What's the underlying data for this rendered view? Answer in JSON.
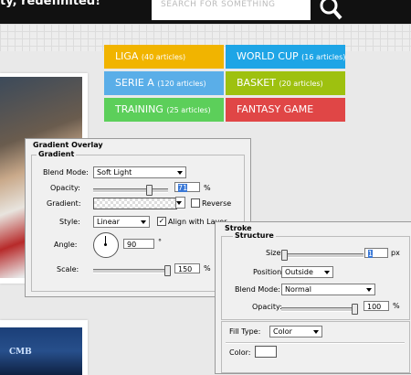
{
  "site": {
    "tagline": "ty, redefinited!",
    "search_placeholder": "SEARCH FOR SOMETHING"
  },
  "tiles": [
    {
      "label": "LIGA",
      "count": "(40 articles)",
      "color": "#f1b400"
    },
    {
      "label": "WORLD CUP",
      "count": "(16 articles)",
      "color": "#1ea5e6"
    },
    {
      "label": "SERIE A",
      "count": "(120 articles)",
      "color": "#5aaee8"
    },
    {
      "label": "BASKET",
      "count": "(20 articles)",
      "color": "#9ec10f"
    },
    {
      "label": "TRAINING",
      "count": "(25 articles)",
      "color": "#5ccf5a"
    },
    {
      "label": "FANTASY GAME",
      "count": "",
      "color": "#e04646"
    }
  ],
  "photo2_caption": "CMB",
  "gradient_overlay": {
    "title": "Gradient Overlay",
    "group_title": "Gradient",
    "blend_mode_label": "Blend Mode:",
    "blend_mode_value": "Soft Light",
    "opacity_label": "Opacity:",
    "opacity_value": "71",
    "opacity_unit": "%",
    "opacity_level": 0.71,
    "gradient_label": "Gradient:",
    "reverse_label": "Reverse",
    "style_label": "Style:",
    "style_value": "Linear",
    "align_label": "Align with Layer",
    "angle_label": "Angle:",
    "angle_value": "90",
    "angle_unit": "°",
    "scale_label": "Scale:",
    "scale_value": "150",
    "scale_unit": "%"
  },
  "stroke": {
    "title": "Stroke",
    "group_title": "Structure",
    "size_label": "Size:",
    "size_value": "1",
    "size_unit": "px",
    "position_label": "Position:",
    "position_value": "Outside",
    "blend_mode_label": "Blend Mode:",
    "blend_mode_value": "Normal",
    "opacity_label": "Opacity:",
    "opacity_value": "100",
    "opacity_unit": "%",
    "fill_type_label": "Fill Type:",
    "fill_type_value": "Color",
    "color_label": "Color:"
  }
}
